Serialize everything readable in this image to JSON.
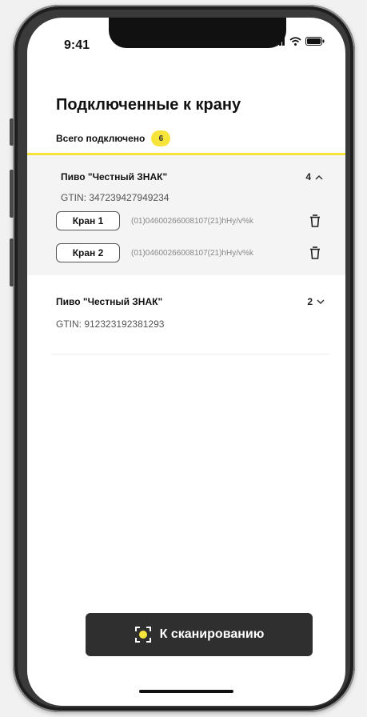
{
  "status_bar": {
    "time": "9:41",
    "signal_icon": "signal-icon",
    "wifi_icon": "wifi-icon",
    "battery_icon": "battery-icon"
  },
  "header": {
    "title": "Подключенные к крану"
  },
  "summary": {
    "label": "Всего подключено",
    "count": "6",
    "accent_color": "#f7e43a"
  },
  "groups": [
    {
      "title": "Пиво \"Честный ЗНАК\"",
      "gtin": "GTIN: 347239427949234",
      "count": "4",
      "expanded": true,
      "taps": [
        {
          "label": "Кран 1",
          "code": "(01)04600266008107(21)hHy/v%k",
          "action_icon": "trash-icon"
        },
        {
          "label": "Кран 2",
          "code": "(01)04600266008107(21)hHy/v%k",
          "action_icon": "trash-icon"
        }
      ]
    },
    {
      "title": "Пиво \"Честный ЗНАК\"",
      "gtin": "GTIN: 912323192381293",
      "count": "2",
      "expanded": false,
      "taps": []
    }
  ],
  "scan_button": {
    "label": "К сканированию",
    "icon": "scan-icon",
    "color": "#2f2f2f"
  }
}
